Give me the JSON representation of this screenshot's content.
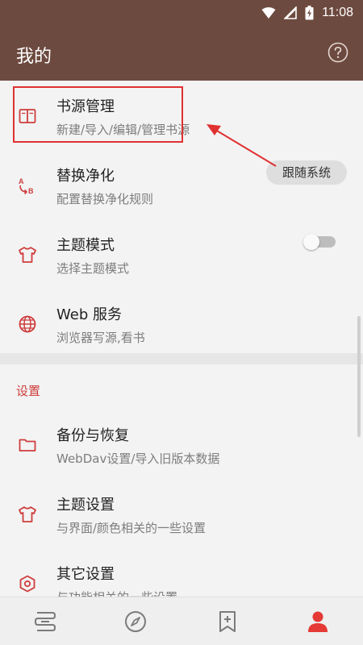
{
  "status_bar": {
    "time": "11:08"
  },
  "header": {
    "title": "我的"
  },
  "items": [
    {
      "title": "书源管理",
      "subtitle": "新建/导入/编辑/管理书源"
    },
    {
      "title": "替换净化",
      "subtitle": "配置替换净化规则"
    },
    {
      "title": "主题模式",
      "subtitle": "选择主题模式",
      "value": "跟随系统"
    },
    {
      "title": "Web 服务",
      "subtitle": "浏览器写源,看书",
      "toggle": false
    }
  ],
  "section_title": "设置",
  "settings": [
    {
      "title": "备份与恢复",
      "subtitle": "WebDav设置/导入旧版本数据"
    },
    {
      "title": "主题设置",
      "subtitle": "与界面/颜色相关的一些设置"
    },
    {
      "title": "其它设置",
      "subtitle": "与功能相关的一些设置"
    }
  ],
  "colors": {
    "brand": "#6d4a3f",
    "accent": "#cf3d3d"
  },
  "icons": {
    "items": [
      "book-icon",
      "replace-icon",
      "tshirt-icon",
      "globe-icon"
    ],
    "settings": [
      "folder-icon",
      "tshirt-icon",
      "hexagon-gear-icon"
    ],
    "tabs": [
      "bookshelf-icon",
      "compass-icon",
      "bookmark-add-icon",
      "person-icon"
    ]
  }
}
